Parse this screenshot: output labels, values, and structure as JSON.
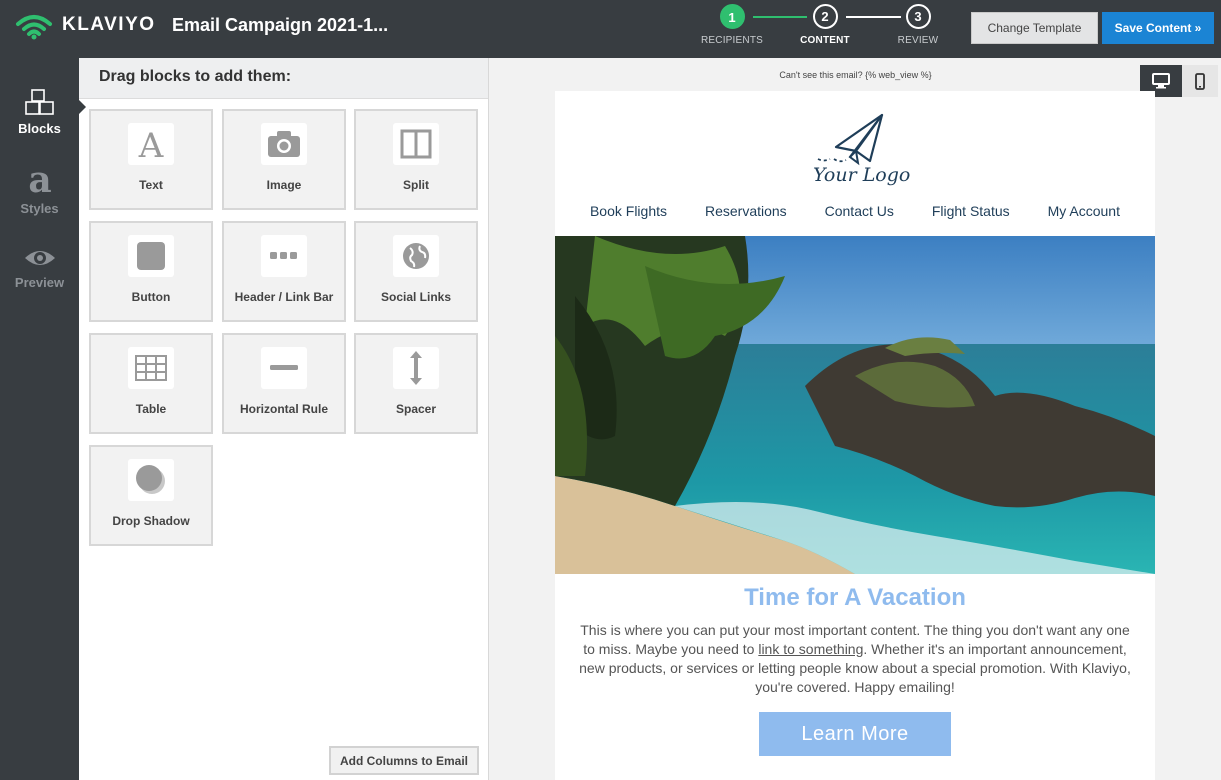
{
  "app": {
    "brand": "KLAVIYO",
    "campaign_title": "Email Campaign 2021-1..."
  },
  "steps": [
    {
      "number": "1",
      "label": "RECIPIENTS",
      "state": "done"
    },
    {
      "number": "2",
      "label": "CONTENT",
      "state": "active"
    },
    {
      "number": "3",
      "label": "REVIEW",
      "state": "pending"
    }
  ],
  "toolbar": {
    "change_template": "Change Template",
    "save_content": "Save Content »"
  },
  "rail": {
    "blocks": "Blocks",
    "styles": "Styles",
    "preview": "Preview"
  },
  "panel": {
    "heading": "Drag blocks to add them:",
    "blocks": [
      "Text",
      "Image",
      "Split",
      "Button",
      "Header / Link Bar",
      "Social Links",
      "Table",
      "Horizontal Rule",
      "Spacer",
      "Drop Shadow"
    ],
    "add_columns": "Add Columns to Email"
  },
  "preview": {
    "web_view_text": "Can't see this email? {% web_view %}",
    "logo_text": "Your Logo",
    "nav": [
      "Book Flights",
      "Reservations",
      "Contact Us",
      "Flight Status",
      "My Account"
    ],
    "headline": "Time for A Vacation",
    "body_before_link": "This is where you can put your most important content. The thing you don't want any one to miss. Maybe you need to ",
    "body_link": "link to something",
    "body_after_link": ". Whether it's an important announcement, new products, or services or letting people know about a special promotion. With Klaviyo, you're covered. Happy emailing!",
    "cta": "Learn More"
  },
  "colors": {
    "topbar": "#383d41",
    "accent_green": "#2fbf6f",
    "save_blue": "#1b84d4",
    "email_accent": "#8fbbee",
    "logo_navy": "#1f3e59"
  }
}
